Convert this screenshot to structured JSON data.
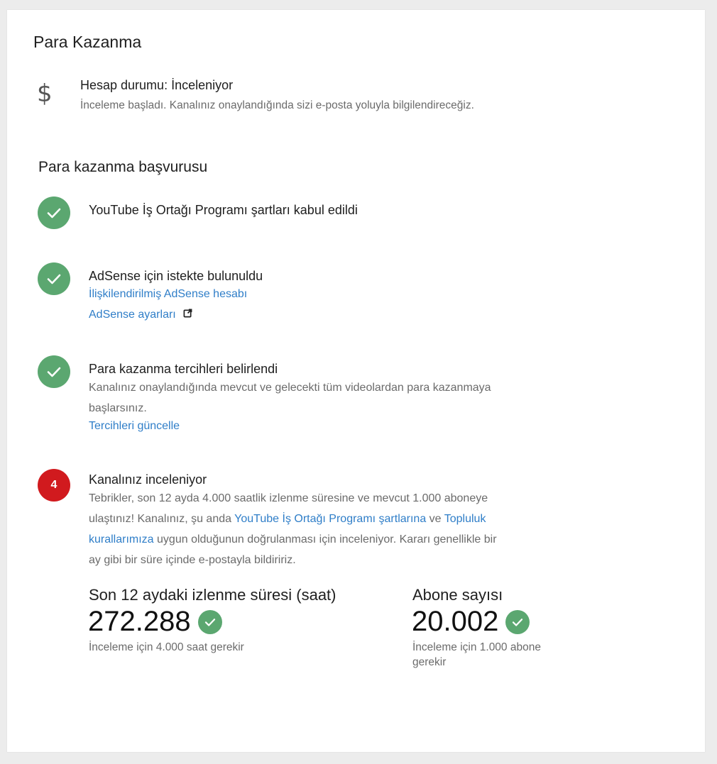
{
  "page": {
    "title": "Para Kazanma"
  },
  "account": {
    "icon": "dollar-icon",
    "status": "Hesap durumu: İnceleniyor",
    "description": "İnceleme başladı. Kanalınız onaylandığında sizi e-posta yoluyla bilgilendireceğiz."
  },
  "application": {
    "section_title": "Para kazanma başvurusu",
    "steps": [
      {
        "state": "done",
        "title": "YouTube İş Ortağı Programı şartları kabul edildi"
      },
      {
        "state": "done",
        "title": "AdSense için istekte bulunuldu",
        "link1": "İlişkilendirilmiş AdSense hesabı",
        "link2": "AdSense ayarları"
      },
      {
        "state": "done",
        "title": "Para kazanma tercihleri belirlendi",
        "text_line1": "Kanalınız onaylandığında mevcut ve gelecekti tüm videolardan para kazanmaya",
        "text_line2": "başlarsınız.",
        "link": "Tercihleri güncelle"
      },
      {
        "state": "current",
        "number": "4",
        "title": "Kanalınız inceleniyor",
        "line1": "Tebrikler, son 12 ayda 4.000 saatlik izlenme süresine ve mevcut 1.000 aboneye",
        "line2_a": "ulaştınız! Kanalınız, şu anda ",
        "line2_link1": "YouTube İş Ortağı Programı şartlarına",
        "line2_b": " ve ",
        "line2_link2": "Topluluk",
        "line3_link": "kurallarımıza",
        "line3_b": " uygun olduğunun doğrulanması için inceleniyor. Kararı genellikle bir",
        "line4": "ay gibi bir süre içinde e-postayla bildiririz."
      }
    ]
  },
  "stats": {
    "watch_time": {
      "label": "Son 12 aydaki izlenme süresi (saat)",
      "value": "272.288",
      "note": "İnceleme için 4.000 saat gerekir"
    },
    "subscribers": {
      "label": "Abone sayısı",
      "value": "20.002",
      "note_line1": "İnceleme için 1.000 abone",
      "note_line2": "gerekir"
    }
  },
  "colors": {
    "success": "#5ba770",
    "alert": "#d11a1e",
    "link": "#2f7ec8"
  }
}
